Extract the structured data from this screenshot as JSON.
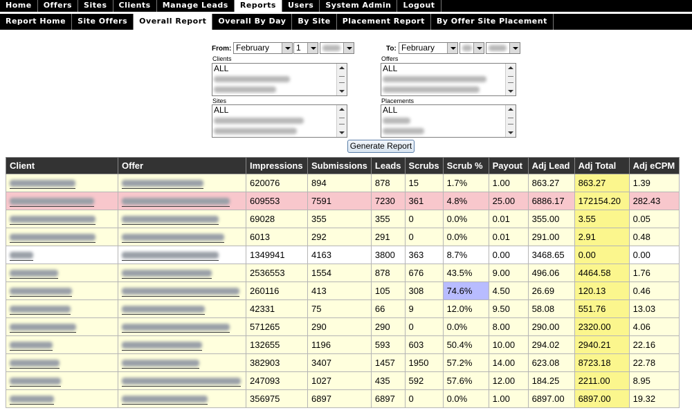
{
  "nav_main": [
    {
      "label": "Home",
      "active": false
    },
    {
      "label": "Offers",
      "active": false
    },
    {
      "label": "Sites",
      "active": false
    },
    {
      "label": "Clients",
      "active": false
    },
    {
      "label": "Manage Leads",
      "active": false
    },
    {
      "label": "Reports",
      "active": true
    },
    {
      "label": "Users",
      "active": false
    },
    {
      "label": "System Admin",
      "active": false
    },
    {
      "label": "Logout",
      "active": false
    }
  ],
  "nav_sub": [
    {
      "label": "Report Home",
      "active": false
    },
    {
      "label": "Site Offers",
      "active": false
    },
    {
      "label": "Overall Report",
      "active": true
    },
    {
      "label": "Overall By Day",
      "active": false
    },
    {
      "label": "By Site",
      "active": false
    },
    {
      "label": "Placement Report",
      "active": false
    },
    {
      "label": "By Offer Site Placement",
      "active": false
    }
  ],
  "filters": {
    "from_label": "From:",
    "from_month": "February",
    "from_day": "1",
    "to_label": "To:",
    "to_month": "February",
    "clients_label": "Clients",
    "clients_first": "ALL",
    "offers_label": "Offers",
    "offers_first": "ALL",
    "sites_label": "Sites",
    "sites_first": "ALL",
    "placements_label": "Placements",
    "placements_first": "ALL",
    "generate_label": "Generate Report"
  },
  "table": {
    "headers": [
      "Client",
      "Offer",
      "Impressions",
      "Submissions",
      "Leads",
      "Scrubs",
      "Scrub %",
      "Payout",
      "Adj Lead",
      "Adj Total",
      "Adj eCPM"
    ],
    "rows": [
      {
        "style": "yellow",
        "highlight_scrub": false,
        "values": [
          "620076",
          "894",
          "878",
          "15",
          "1.7%",
          "1.00",
          "863.27",
          "863.27",
          "1.39"
        ]
      },
      {
        "style": "pink",
        "highlight_scrub": false,
        "values": [
          "609553",
          "7591",
          "7230",
          "361",
          "4.8%",
          "25.00",
          "6886.17",
          "172154.20",
          "282.43"
        ]
      },
      {
        "style": "yellow",
        "highlight_scrub": false,
        "values": [
          "69028",
          "355",
          "355",
          "0",
          "0.0%",
          "0.01",
          "355.00",
          "3.55",
          "0.05"
        ]
      },
      {
        "style": "yellow",
        "highlight_scrub": false,
        "values": [
          "6013",
          "292",
          "291",
          "0",
          "0.0%",
          "0.01",
          "291.00",
          "2.91",
          "0.48"
        ]
      },
      {
        "style": "white",
        "highlight_scrub": false,
        "values": [
          "1349941",
          "4163",
          "3800",
          "363",
          "8.7%",
          "0.00",
          "3468.65",
          "0.00",
          "0.00"
        ]
      },
      {
        "style": "yellow",
        "highlight_scrub": false,
        "values": [
          "2536553",
          "1554",
          "878",
          "676",
          "43.5%",
          "9.00",
          "496.06",
          "4464.58",
          "1.76"
        ]
      },
      {
        "style": "yellow",
        "highlight_scrub": true,
        "values": [
          "260116",
          "413",
          "105",
          "308",
          "74.6%",
          "4.50",
          "26.69",
          "120.13",
          "0.46"
        ]
      },
      {
        "style": "yellow",
        "highlight_scrub": false,
        "values": [
          "42331",
          "75",
          "66",
          "9",
          "12.0%",
          "9.50",
          "58.08",
          "551.76",
          "13.03"
        ]
      },
      {
        "style": "yellow",
        "highlight_scrub": false,
        "values": [
          "571265",
          "290",
          "290",
          "0",
          "0.0%",
          "8.00",
          "290.00",
          "2320.00",
          "4.06"
        ]
      },
      {
        "style": "yellow",
        "highlight_scrub": false,
        "values": [
          "132655",
          "1196",
          "593",
          "603",
          "50.4%",
          "10.00",
          "294.02",
          "2940.21",
          "22.16"
        ]
      },
      {
        "style": "yellow",
        "highlight_scrub": false,
        "values": [
          "382903",
          "3407",
          "1457",
          "1950",
          "57.2%",
          "14.00",
          "623.08",
          "8723.18",
          "22.78"
        ]
      },
      {
        "style": "yellow",
        "highlight_scrub": false,
        "values": [
          "247093",
          "1027",
          "435",
          "592",
          "57.6%",
          "12.00",
          "184.25",
          "2211.00",
          "8.95"
        ]
      },
      {
        "style": "yellow",
        "highlight_scrub": false,
        "values": [
          "356975",
          "6897",
          "6897",
          "0",
          "0.0%",
          "1.00",
          "6897.00",
          "6897.00",
          "19.32"
        ]
      }
    ]
  },
  "colors": {
    "header_bg": "#333333",
    "row_yellow": "#ffffdd",
    "row_pink": "#f8c7cc",
    "adj_total": "#fbf68d",
    "scrub_highlight": "#b8bcff"
  }
}
